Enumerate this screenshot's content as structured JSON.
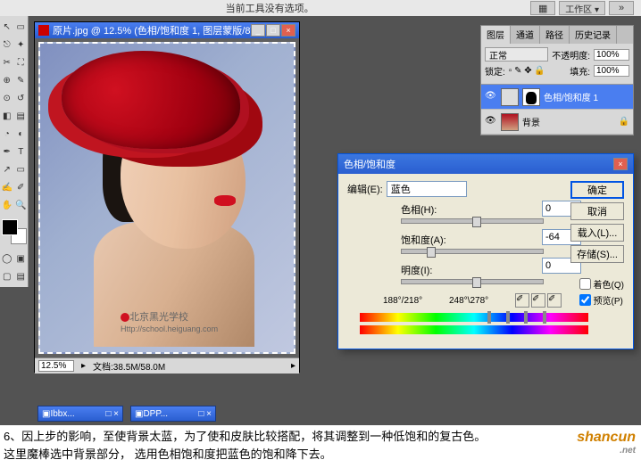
{
  "options_bar": {
    "message": "当前工具没有选项。",
    "workspace_label": "工作区 ▾"
  },
  "doc": {
    "title": "原片.jpg @ 12.5% (色相/饱和度 1, 图层蒙版/8)",
    "zoom": "12.5%",
    "status": "文档:38.5M/58.0M",
    "watermark_main": "北京黑光学校",
    "watermark_url": "Http://school.heiguang.com"
  },
  "layers_panel": {
    "tabs": [
      "图层",
      "通道",
      "路径",
      "历史记录"
    ],
    "blend_mode": "正常",
    "opacity_label": "不透明度:",
    "opacity_value": "100%",
    "lock_label": "锁定:",
    "fill_label": "填充:",
    "fill_value": "100%",
    "items": [
      {
        "name": "色相/饱和度 1"
      },
      {
        "name": "背景"
      }
    ]
  },
  "hue_dialog": {
    "title": "色相/饱和度",
    "edit_label": "编辑(E):",
    "edit_value": "蓝色",
    "hue_label": "色相(H):",
    "hue_value": "0",
    "sat_label": "饱和度(A):",
    "sat_value": "-64",
    "light_label": "明度(I):",
    "light_value": "0",
    "angle1": "188°/218°",
    "angle2": "248°\\278°",
    "buttons": {
      "ok": "确定",
      "cancel": "取消",
      "load": "载入(L)...",
      "save": "存储(S)..."
    },
    "colorize_label": "着色(Q)",
    "preview_label": "预览(P)"
  },
  "taskbar": {
    "items": [
      "Ibbx...",
      "DPP..."
    ]
  },
  "caption": {
    "line1": "6、因上步的影响，至使背景太蓝，为了使和皮肤比较搭配，将其调整到一种低饱和的复古色。",
    "line2": "这里魔棒选中背景部分， 选用色相饱和度把蓝色的饱和降下去。"
  },
  "site_watermark": {
    "part1": "shan",
    "part2": "cun",
    "suffix": ".net"
  }
}
